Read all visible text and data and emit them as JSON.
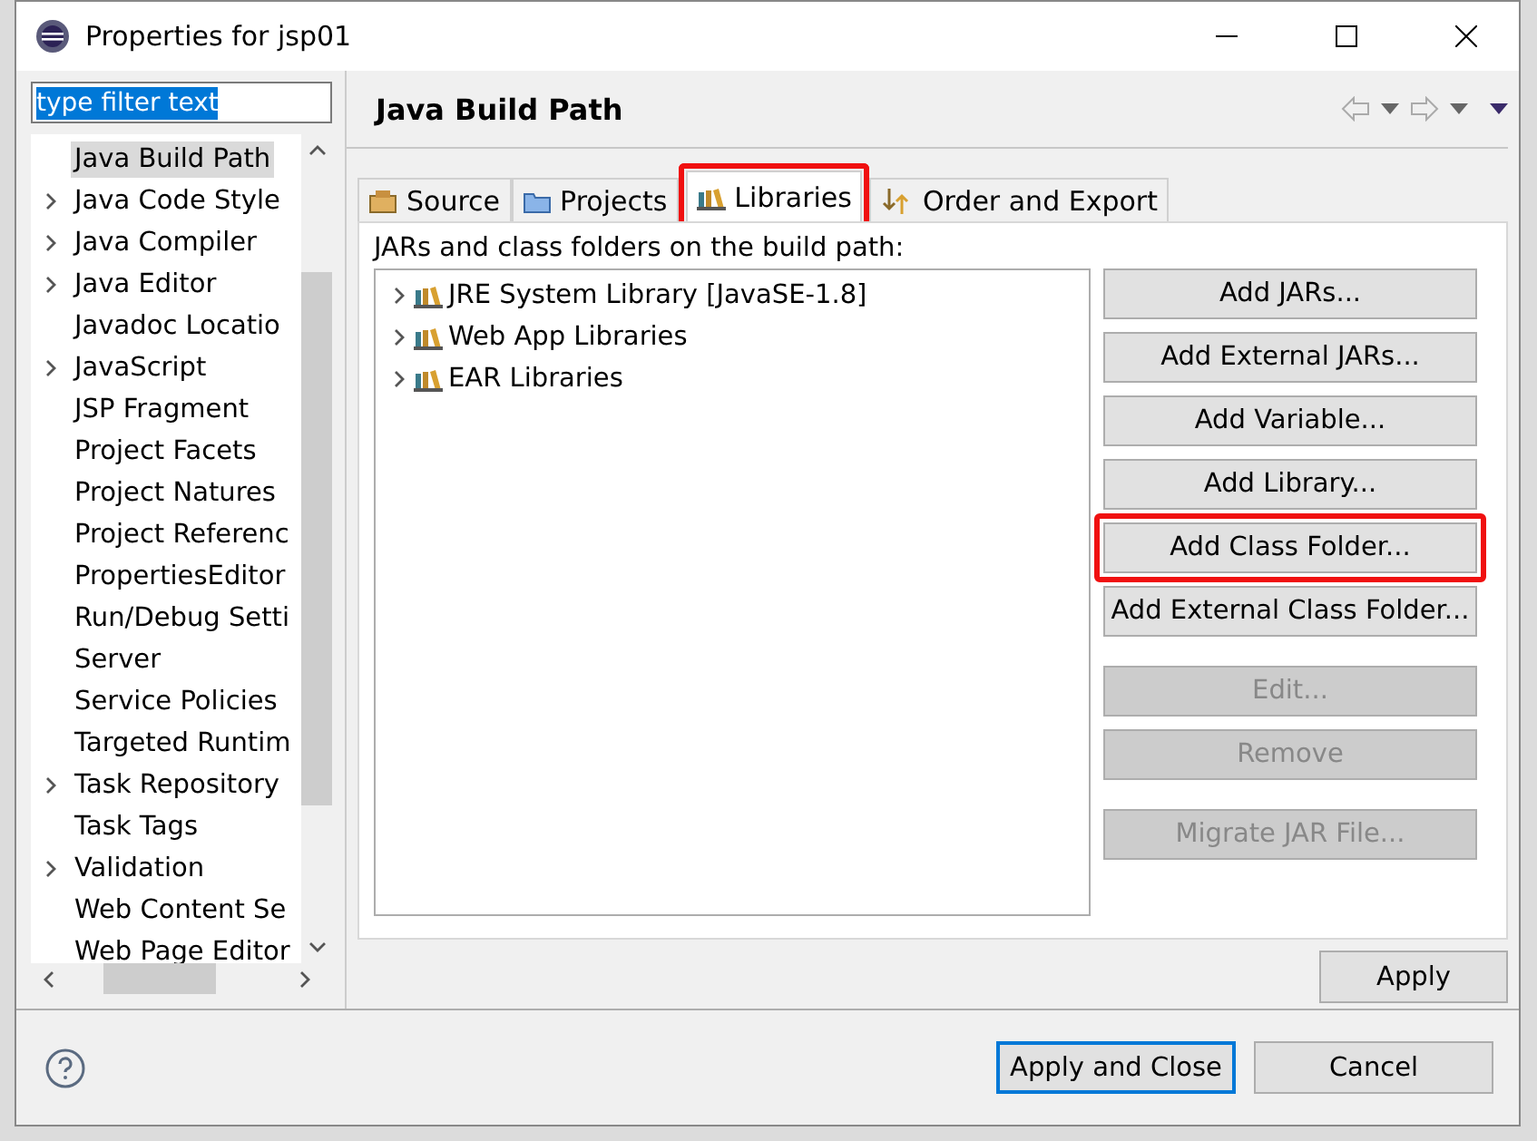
{
  "window": {
    "title": "Properties for jsp01"
  },
  "filter": {
    "value": "type filter text"
  },
  "sidebar": {
    "items": [
      {
        "label": "Java Build Path",
        "expandable": false,
        "selected": true
      },
      {
        "label": "Java Code Style",
        "expandable": true,
        "selected": false
      },
      {
        "label": "Java Compiler",
        "expandable": true,
        "selected": false
      },
      {
        "label": "Java Editor",
        "expandable": true,
        "selected": false
      },
      {
        "label": "Javadoc Locatio",
        "expandable": false,
        "selected": false
      },
      {
        "label": "JavaScript",
        "expandable": true,
        "selected": false
      },
      {
        "label": "JSP Fragment",
        "expandable": false,
        "selected": false
      },
      {
        "label": "Project Facets",
        "expandable": false,
        "selected": false
      },
      {
        "label": "Project Natures",
        "expandable": false,
        "selected": false
      },
      {
        "label": "Project Referenc",
        "expandable": false,
        "selected": false
      },
      {
        "label": "PropertiesEditor",
        "expandable": false,
        "selected": false
      },
      {
        "label": "Run/Debug Setti",
        "expandable": false,
        "selected": false
      },
      {
        "label": "Server",
        "expandable": false,
        "selected": false
      },
      {
        "label": "Service Policies",
        "expandable": false,
        "selected": false
      },
      {
        "label": "Targeted Runtim",
        "expandable": false,
        "selected": false
      },
      {
        "label": "Task Repository",
        "expandable": true,
        "selected": false
      },
      {
        "label": "Task Tags",
        "expandable": false,
        "selected": false
      },
      {
        "label": "Validation",
        "expandable": true,
        "selected": false
      },
      {
        "label": "Web Content Se",
        "expandable": false,
        "selected": false
      },
      {
        "label": "Web Page Editor",
        "expandable": false,
        "selected": false
      }
    ]
  },
  "page": {
    "title": "Java Build Path",
    "tabs": [
      {
        "label": "Source",
        "kind": "source",
        "selected": false,
        "highlighted": false
      },
      {
        "label": "Projects",
        "kind": "projects",
        "selected": false,
        "highlighted": false
      },
      {
        "label": "Libraries",
        "kind": "libraries",
        "selected": true,
        "highlighted": true
      },
      {
        "label": "Order and Export",
        "kind": "order",
        "selected": false,
        "highlighted": false
      }
    ],
    "list_label": "JARs and class folders on the build path:",
    "libraries": [
      {
        "label": "JRE System Library [JavaSE-1.8]"
      },
      {
        "label": "Web App Libraries"
      },
      {
        "label": "EAR Libraries"
      }
    ],
    "buttons": [
      {
        "label": "Add JARs...",
        "disabled": false,
        "highlighted": false
      },
      {
        "label": "Add External JARs...",
        "disabled": false,
        "highlighted": false
      },
      {
        "label": "Add Variable...",
        "disabled": false,
        "highlighted": false
      },
      {
        "label": "Add Library...",
        "disabled": false,
        "highlighted": false
      },
      {
        "label": "Add Class Folder...",
        "disabled": false,
        "highlighted": true
      },
      {
        "label": "Add External Class Folder...",
        "disabled": false,
        "highlighted": false
      },
      {
        "label": "Edit...",
        "disabled": true,
        "highlighted": false
      },
      {
        "label": "Remove",
        "disabled": true,
        "highlighted": false
      },
      {
        "label": "Migrate JAR File...",
        "disabled": true,
        "highlighted": false
      }
    ],
    "apply": {
      "label": "Apply"
    }
  },
  "footer": {
    "buttons": [
      {
        "label": "Apply and Close",
        "default": true
      },
      {
        "label": "Cancel",
        "default": false
      }
    ]
  }
}
